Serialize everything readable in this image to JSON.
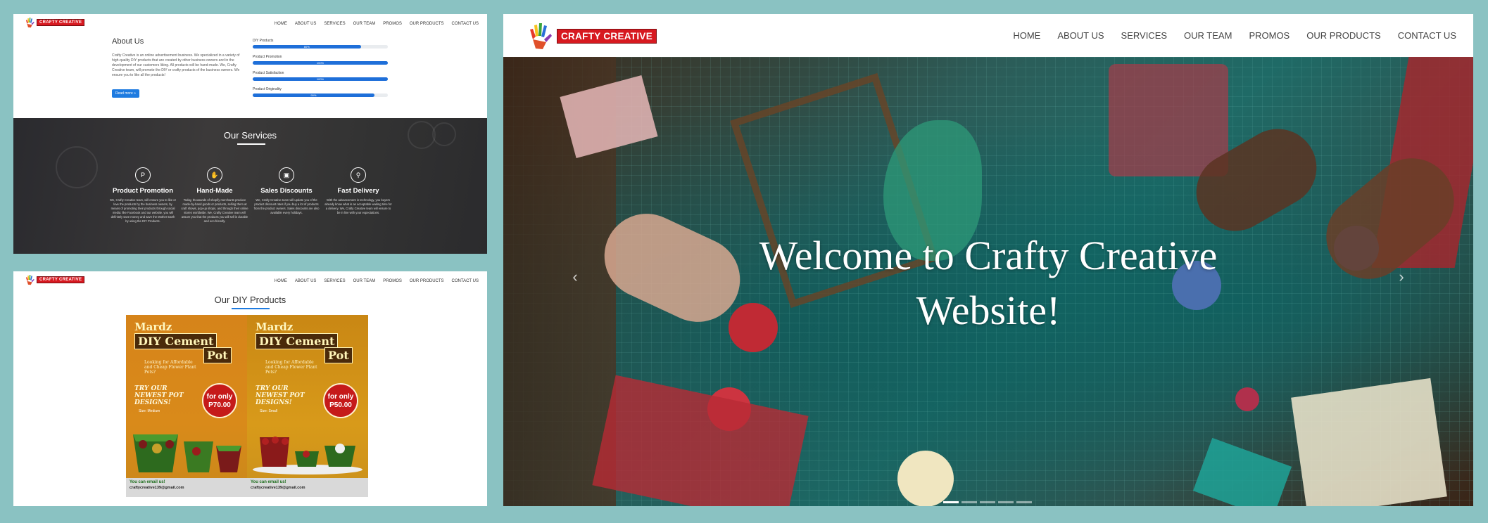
{
  "brand": {
    "logo_text": "CRAFTY CREATIVE"
  },
  "nav": [
    "HOME",
    "ABOUT US",
    "SERVICES",
    "OUR TEAM",
    "PROMOS",
    "OUR PRODUCTS",
    "CONTACT US"
  ],
  "about": {
    "title": "About Us",
    "text": "Crafty Creative is an online advertisement business. We specialized in a variety of high-quality DIY products that are created by other business owners and in the development of our customers liking. All products will be hand-made. We, Crafty Creative team, will promote the DIY or crafty products of the business owners. We ensure you to like all the products!",
    "read_more": "Read more »",
    "skills": [
      {
        "name": "DIY Products",
        "percent": "80%",
        "value": 80
      },
      {
        "name": "Product Promotion",
        "percent": "100%",
        "value": 100
      },
      {
        "name": "Product Satisfaction",
        "percent": "100%",
        "value": 100
      },
      {
        "name": "Product Originality",
        "percent": "90%",
        "value": 90
      }
    ]
  },
  "services": {
    "title": "Our Services",
    "items": [
      {
        "icon": "P",
        "title": "Product Promotion",
        "desc": "We, Crafty Creative team, will ensure you to like or love the products by the business owners, by means of promoting their products through social media: like Facebook and our website. you will definitely save money and save the Mother Earth by using the DIY Products."
      },
      {
        "icon": "✋",
        "title": "Hand-Made",
        "desc": "Today, thousands of shopify merchants produce made-by-hand goods or products, selling them at craft shows, pop-up shops, and through their online stores worldwide. We, Crafty Creative team will assure you that the products you will sell is durable and eco-friendly."
      },
      {
        "icon": "▣",
        "title": "Sales Discounts",
        "desc": "We, Crafty Creative team will update you of the product discount rates if you buy a lot of products from the product owners. Sales discounts are also available every holidays."
      },
      {
        "icon": "⚲",
        "title": "Fast Delivery",
        "desc": "With the advancement in technology, you buyers already know what is an acceptable waiting time for a delivery. We, Crafty Creative team will ensure to be in line with your expectations."
      }
    ]
  },
  "products": {
    "title": "Our DIY Products",
    "posters": [
      {
        "brand": "Mardz",
        "line1": "DIY Cement",
        "line2": "Pot",
        "sub": "Looking for Affordable and Cheap Flower Plant Pots?",
        "try": "TRY OUR NEWEST POT DESIGNS!",
        "price_label": "for only",
        "price": "P70.00",
        "size": "Size: Medium",
        "email_label": "You can email us!",
        "email": "craftycreative139@gmail.com"
      },
      {
        "brand": "Mardz",
        "line1": "DIY Cement",
        "line2": "Pot",
        "sub": "Looking for Affordable and Cheap Flower Plant Pots?",
        "try": "TRY OUR NEWEST POT DESIGNS!",
        "price_label": "for only",
        "price": "P50.00",
        "size": "Size: Small",
        "email_label": "You can email us!",
        "email": "craftycreative139@gmail.com"
      }
    ]
  },
  "hero": {
    "line1": "Welcome to Crafty Creative",
    "line2": "Website!",
    "prev": "‹",
    "next": "›",
    "indicator_count": 5,
    "active_indicator": 0
  },
  "colors": {
    "brand_red": "#d71920",
    "accent_blue": "#1e7be0",
    "background": "#8ac2c2"
  }
}
